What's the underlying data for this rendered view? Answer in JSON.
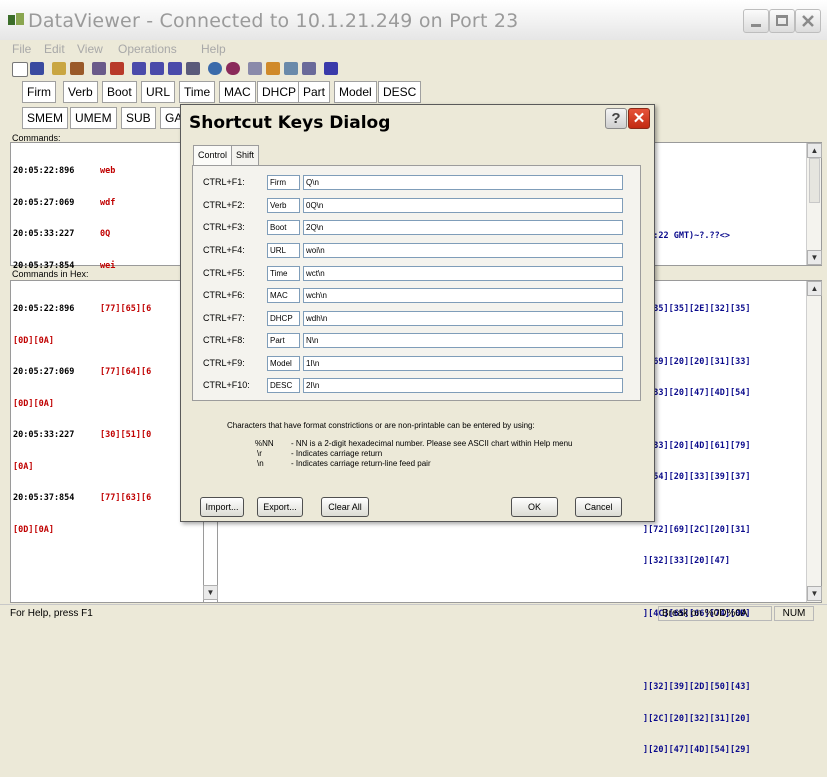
{
  "window": {
    "title": "DataViewer - Connected to 10.1.21.249 on Port 23"
  },
  "menu": [
    "File",
    "Edit",
    "View",
    "Operations",
    "Help"
  ],
  "shortcut_buttons_row1": [
    "Firm",
    "Verb",
    "Boot",
    "URL",
    "Time",
    "MAC",
    "DHCP",
    "Part",
    "Model",
    "DESC"
  ],
  "shortcut_buttons_row2": [
    "SMEM",
    "UMEM",
    "SUB",
    "GA"
  ],
  "commands_pane": {
    "label": "Commands:",
    "rows": [
      {
        "time": "20:05:22:896",
        "cmd": "web"
      },
      {
        "time": "20:05:27:069",
        "cmd": "wdf"
      },
      {
        "time": "20:05:33:227",
        "cmd": "0Q"
      },
      {
        "time": "20:05:37:854",
        "cmd": "wei"
      }
    ],
    "right_text": "00:22 GMT)~?.??<>"
  },
  "hex_pane": {
    "label": "Commands in Hex:",
    "rows": [
      {
        "time": "20:05:22:896",
        "hex": "[77][65][6",
        "cont": "[0D][0A]"
      },
      {
        "time": "20:05:27:069",
        "hex": "[77][64][6",
        "cont": "[0D][0A]"
      },
      {
        "time": "20:05:33:227",
        "hex": "[30][51][0",
        "cont": "[0A]"
      },
      {
        "time": "20:05:37:854",
        "hex": "[77][63][6",
        "cont": "[0D][0A]"
      }
    ],
    "right_lines": [
      "][35][35][2E][32][35]",
      "",
      "][69][20][20][31][33]",
      "][33][20][47][4D][54]",
      "",
      "][33][20][4D][61][79]",
      "][54][20][33][39][37]",
      "",
      "][72][69][2C][20][31]",
      "][32][33][20][47]",
      "",
      "][4C][65][66][74][0D]",
      "",
      "",
      "][32][39][2D][50][43]",
      "][2C][20][32][31][20]",
      "][20][47][4D][54][29]"
    ]
  },
  "status": {
    "left": "For Help, press F1",
    "break": "Break on %0D%0A",
    "num": "NUM"
  },
  "dialog": {
    "title": "Shortcut Keys Dialog",
    "help_glyph": "?",
    "close_glyph": "✕",
    "tabs": [
      "Control",
      "Shift"
    ],
    "keys": [
      {
        "key": "CTRL+F1:",
        "name": "Firm",
        "value": "Q\\n"
      },
      {
        "key": "CTRL+F2:",
        "name": "Verb",
        "value": "0Q\\n"
      },
      {
        "key": "CTRL+F3:",
        "name": "Boot",
        "value": "2Q\\n"
      },
      {
        "key": "CTRL+F4:",
        "name": "URL",
        "value": "woi\\n"
      },
      {
        "key": "CTRL+F5:",
        "name": "Time",
        "value": "wct\\n"
      },
      {
        "key": "CTRL+F6:",
        "name": "MAC",
        "value": "wch\\n"
      },
      {
        "key": "CTRL+F7:",
        "name": "DHCP",
        "value": "wdh\\n"
      },
      {
        "key": "CTRL+F8:",
        "name": "Part",
        "value": "N\\n"
      },
      {
        "key": "CTRL+F9:",
        "name": "Model",
        "value": "1I\\n"
      },
      {
        "key": "CTRL+F10:",
        "name": "DESC",
        "value": "2I\\n"
      }
    ],
    "info_heading": "Characters that have format constrictions or are non-printable can be entered by using:",
    "info_rows": [
      {
        "code": "%NN",
        "desc": "- NN is a 2-digit hexadecimal number. Please see ASCII chart within Help menu"
      },
      {
        "code": "\\r",
        "desc": "- Indicates carriage return"
      },
      {
        "code": "\\n",
        "desc": "- Indicates carriage return-line feed pair"
      }
    ],
    "buttons": {
      "import": "Import...",
      "export": "Export...",
      "clear_all": "Clear All",
      "ok": "OK",
      "cancel": "Cancel"
    }
  },
  "colors": {
    "command_text": "#c00000",
    "hex_blue": "#0a0a8c",
    "dialog_close": "#d23c20"
  }
}
